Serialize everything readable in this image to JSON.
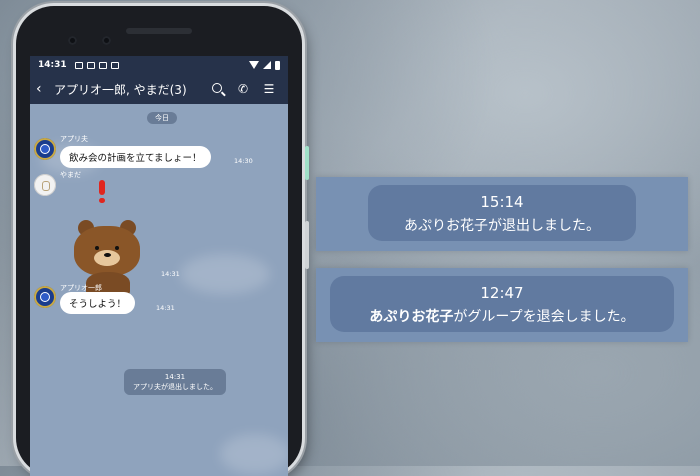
{
  "phone": {
    "statusbar": {
      "time": "14:31"
    },
    "chat_header": {
      "back_icon": "chevron-left-icon",
      "title": "アプリオ一郎, やまだ(3)",
      "search_icon": "search-icon",
      "call_icon": "phone-icon",
      "menu_icon": "menu-icon"
    },
    "date_divider": "今日",
    "messages": [
      {
        "sender": "アプリ夫",
        "text": "飲み会の計画を立てましょー！",
        "time": "14:30"
      },
      {
        "sender": "やまだ",
        "sticker": "brown-bear-exclamation",
        "time": "14:31"
      },
      {
        "sender": "アプリオ一郎",
        "text": "そうしよう！",
        "time": "14:31"
      }
    ],
    "system_message": {
      "time": "14:31",
      "text": "アプリ夫が退出しました。"
    }
  },
  "notifications": [
    {
      "time": "15:14",
      "name": "あぷりお花子",
      "rest": "が退出しました。"
    },
    {
      "time": "12:47",
      "name": "あぷりお花子",
      "rest": "がグループを退会しました。"
    }
  ],
  "colors": {
    "header_bg": "#26324a",
    "chat_bg": "#8fa3bd",
    "panel_bg": "#7891b3",
    "pill_bg": "#617aa0"
  }
}
